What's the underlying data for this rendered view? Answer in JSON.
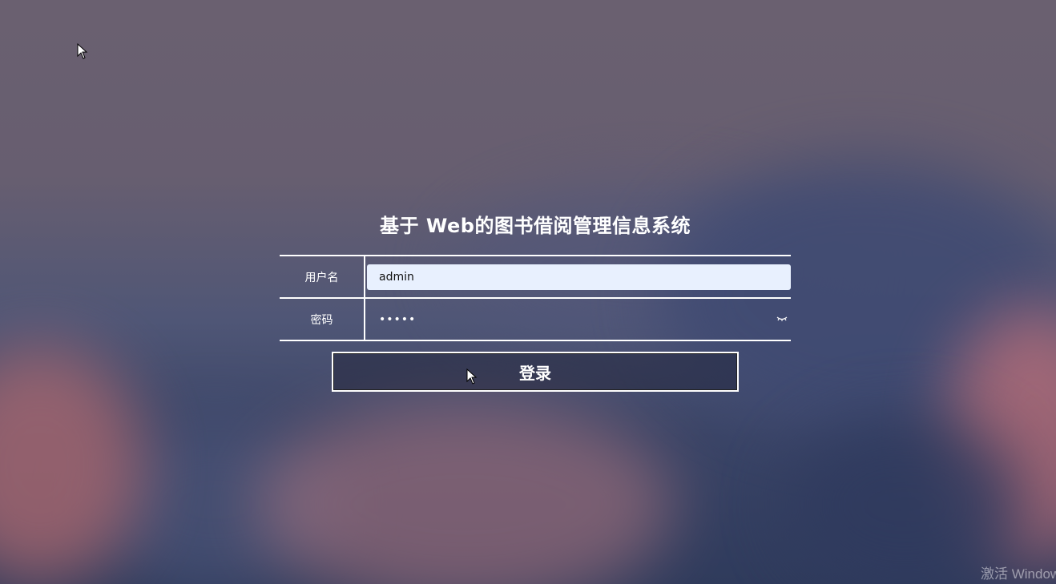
{
  "page": {
    "title": "基于 Web的图书借阅管理信息系统"
  },
  "form": {
    "username_label": "用户名",
    "username_value": "admin",
    "password_label": "密码",
    "password_value": "•••••",
    "password_toggle_icon": "eye-closed-icon"
  },
  "actions": {
    "login_label": "登录"
  },
  "system": {
    "watermark": "激活 Windows"
  },
  "colors": {
    "text": "#ffffff",
    "input_bg": "#e8f0fe",
    "border": "#ffffff"
  }
}
